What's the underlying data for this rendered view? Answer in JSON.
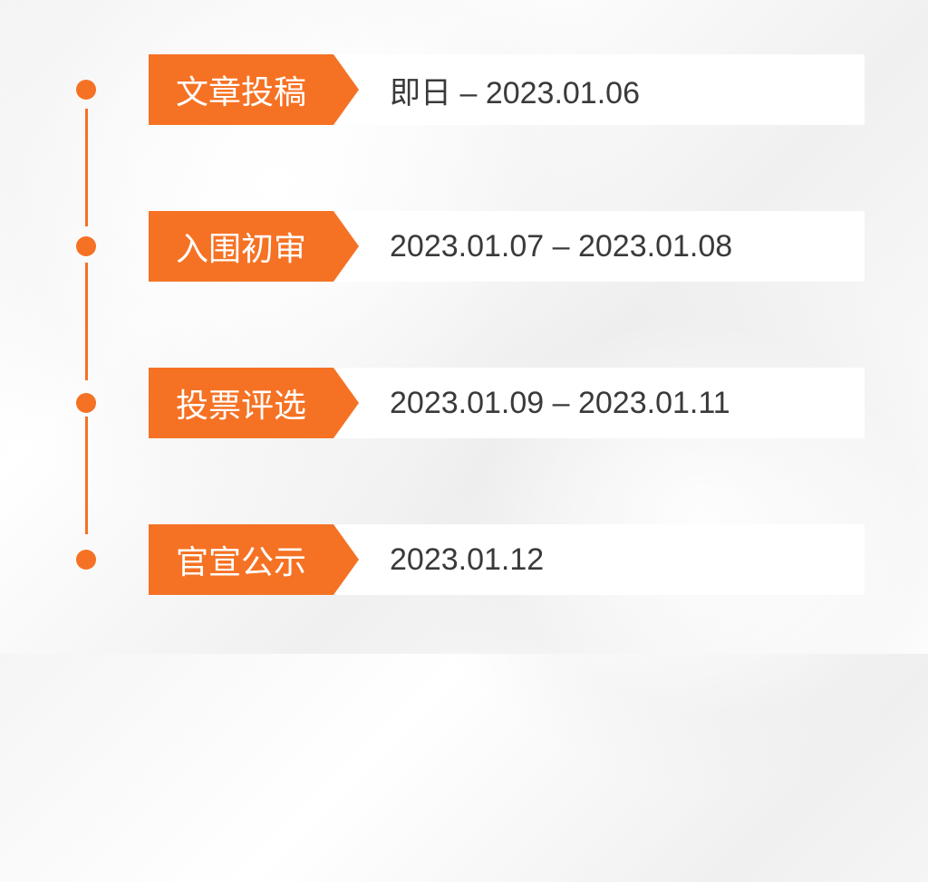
{
  "colors": {
    "accent": "#f57224",
    "text": "#3a3a3a",
    "card": "#ffffff"
  },
  "timeline": {
    "items": [
      {
        "label": "文章投稿",
        "date": "即日 – 2023.01.06"
      },
      {
        "label": "入围初审",
        "date": "2023.01.07 – 2023.01.08"
      },
      {
        "label": "投票评选",
        "date": "2023.01.09 – 2023.01.11"
      },
      {
        "label": "官宣公示",
        "date": "2023.01.12"
      }
    ]
  }
}
